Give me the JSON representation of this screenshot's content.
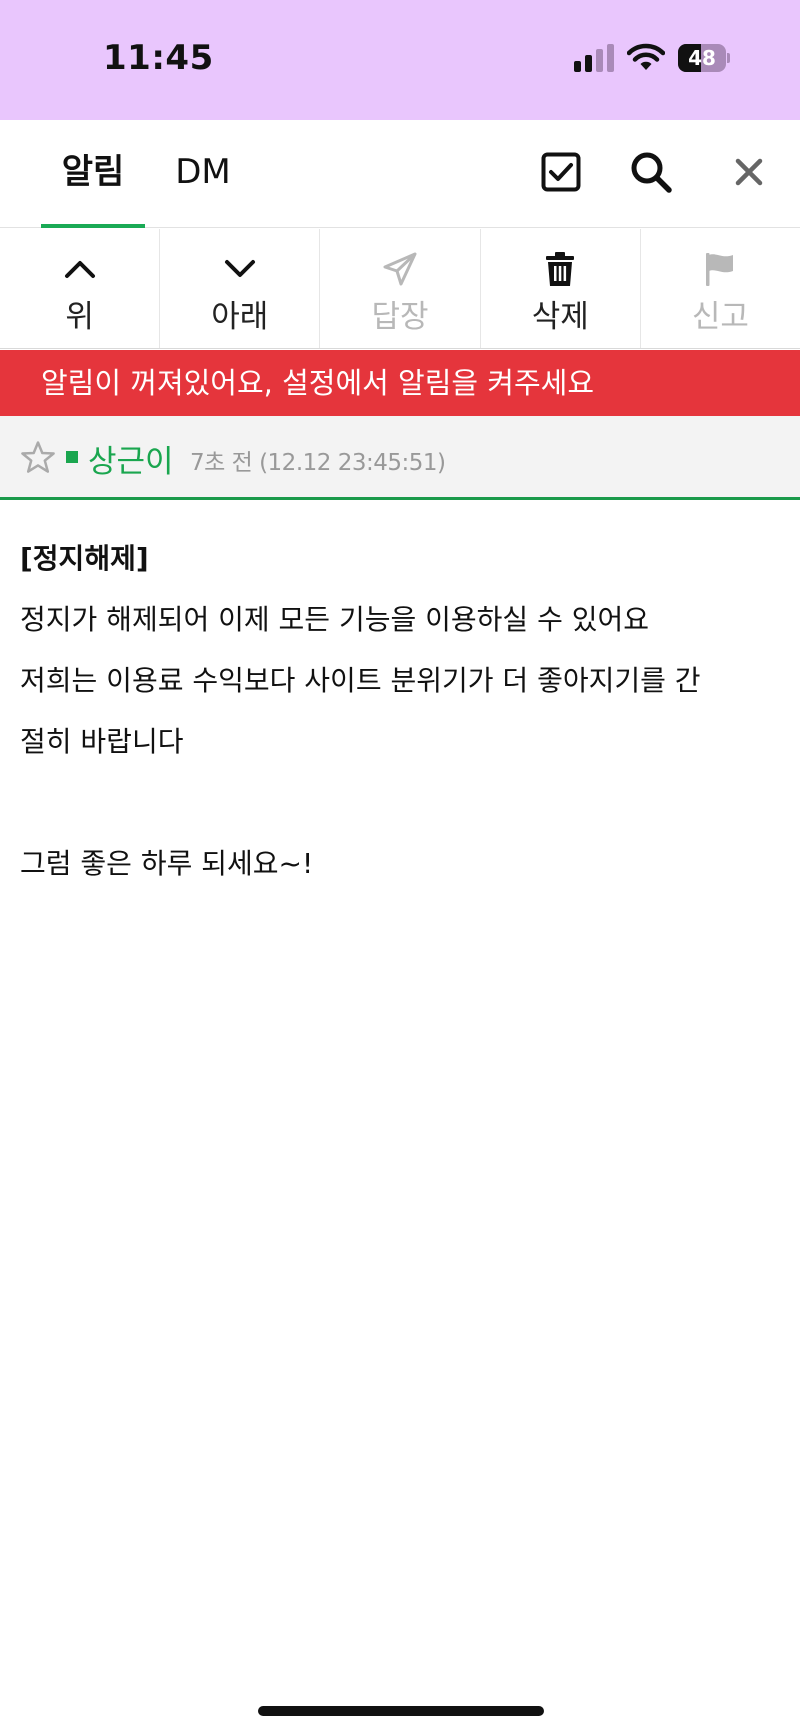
{
  "status_bar": {
    "time": "11:45",
    "battery_percent": 48,
    "battery_label": "48",
    "signal_bars_active": 2,
    "signal_bars_total": 4,
    "background": "#e9c6fd"
  },
  "tabs": [
    {
      "label": "알림",
      "active": true
    },
    {
      "label": "DM",
      "active": false
    }
  ],
  "top_icons": [
    "checkbox-icon",
    "search-icon",
    "close-icon"
  ],
  "toolbar": {
    "up": {
      "label": "위",
      "enabled": true,
      "icon": "chevron-up-icon"
    },
    "down": {
      "label": "아래",
      "enabled": true,
      "icon": "chevron-down-icon"
    },
    "reply": {
      "label": "답장",
      "enabled": false,
      "icon": "paper-plane-icon"
    },
    "delete": {
      "label": "삭제",
      "enabled": true,
      "icon": "trash-icon"
    },
    "report": {
      "label": "신고",
      "enabled": false,
      "icon": "flag-icon"
    }
  },
  "banner": {
    "text": "알림이 꺼져있어요, 설정에서 알림을 켜주세요",
    "color": "#e5353c"
  },
  "message": {
    "sender": "상근이",
    "time": "7초 전 (12.12 23:45:51)",
    "accent": "#1aa64f",
    "title": "[정지해제]",
    "lines": [
      "정지가 해제되어 이제 모든 기능을 이용하실 수 있어요",
      "저희는 이용료 수익보다 사이트 분위기가 더 좋아지기를 간",
      "절히 바랍니다",
      "",
      "그럼 좋은 하루 되세요~!"
    ]
  }
}
